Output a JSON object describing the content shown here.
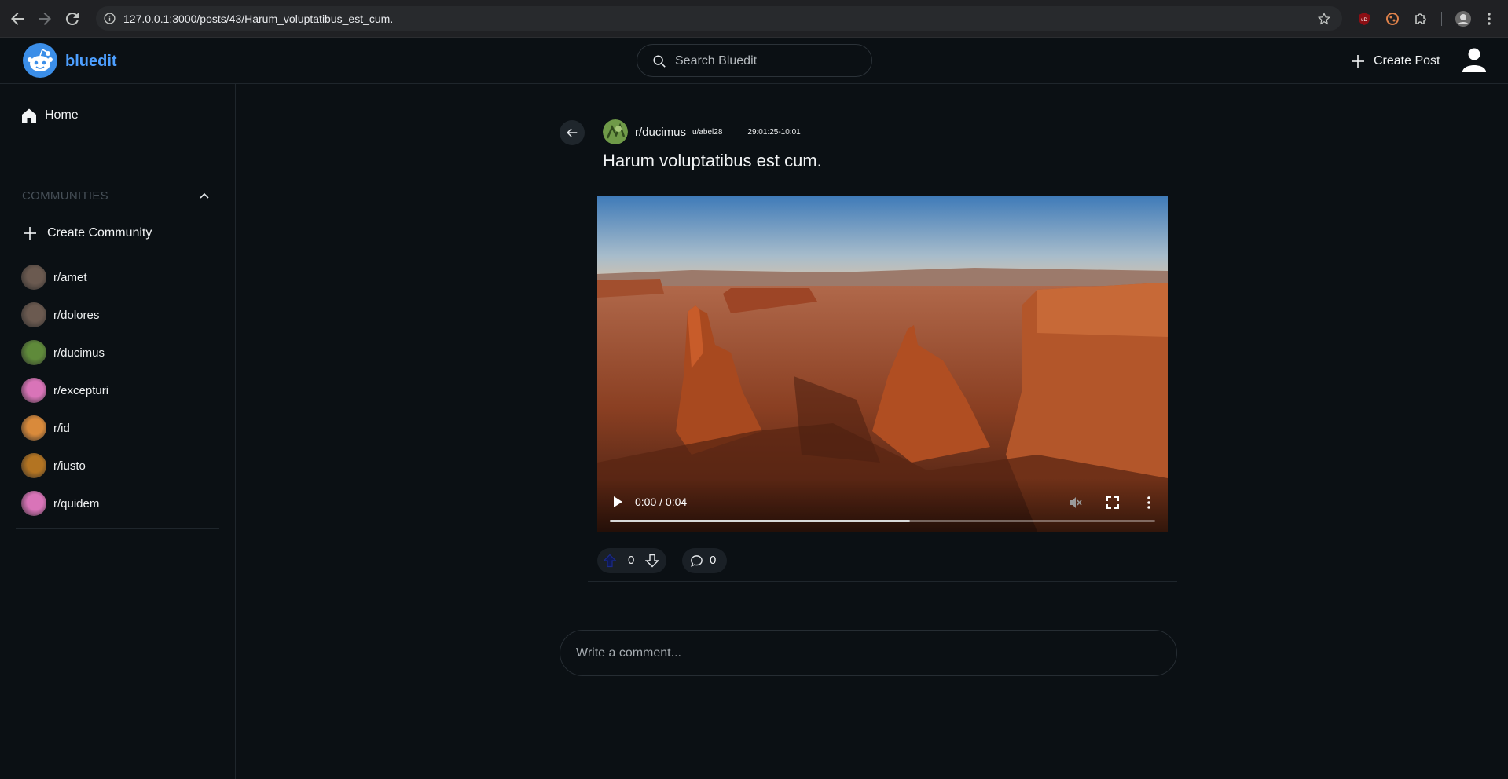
{
  "browser": {
    "url": "127.0.0.1:3000/posts/43/Harum_voluptatibus_est_cum."
  },
  "header": {
    "brand": "bluedit",
    "search_placeholder": "Search Bluedit",
    "create_post_label": "Create Post",
    "brand_color": "#4d9fff"
  },
  "sidebar": {
    "home_label": "Home",
    "communities_heading": "COMMUNITIES",
    "create_community_label": "Create Community",
    "communities": [
      {
        "name": "r/amet",
        "avatar_color": "#6b5a50"
      },
      {
        "name": "r/dolores",
        "avatar_color": "#6b5a50"
      },
      {
        "name": "r/ducimus",
        "avatar_color": "#5f8a3a"
      },
      {
        "name": "r/excepturi",
        "avatar_color": "#d974b8"
      },
      {
        "name": "r/id",
        "avatar_color": "#d98a3b"
      },
      {
        "name": "r/iusto",
        "avatar_color": "#b37422"
      },
      {
        "name": "r/quidem",
        "avatar_color": "#d974b8"
      }
    ]
  },
  "post": {
    "subreddit": "r/ducimus",
    "author": "u/abel28",
    "timestamp": "29:01:25-10:01",
    "title": "Harum voluptatibus est cum.",
    "video": {
      "time": "0:00 / 0:04",
      "buffered_fraction": 0.55
    },
    "votes": "0",
    "comments": "0"
  },
  "comment_box": {
    "placeholder": "Write a comment..."
  }
}
